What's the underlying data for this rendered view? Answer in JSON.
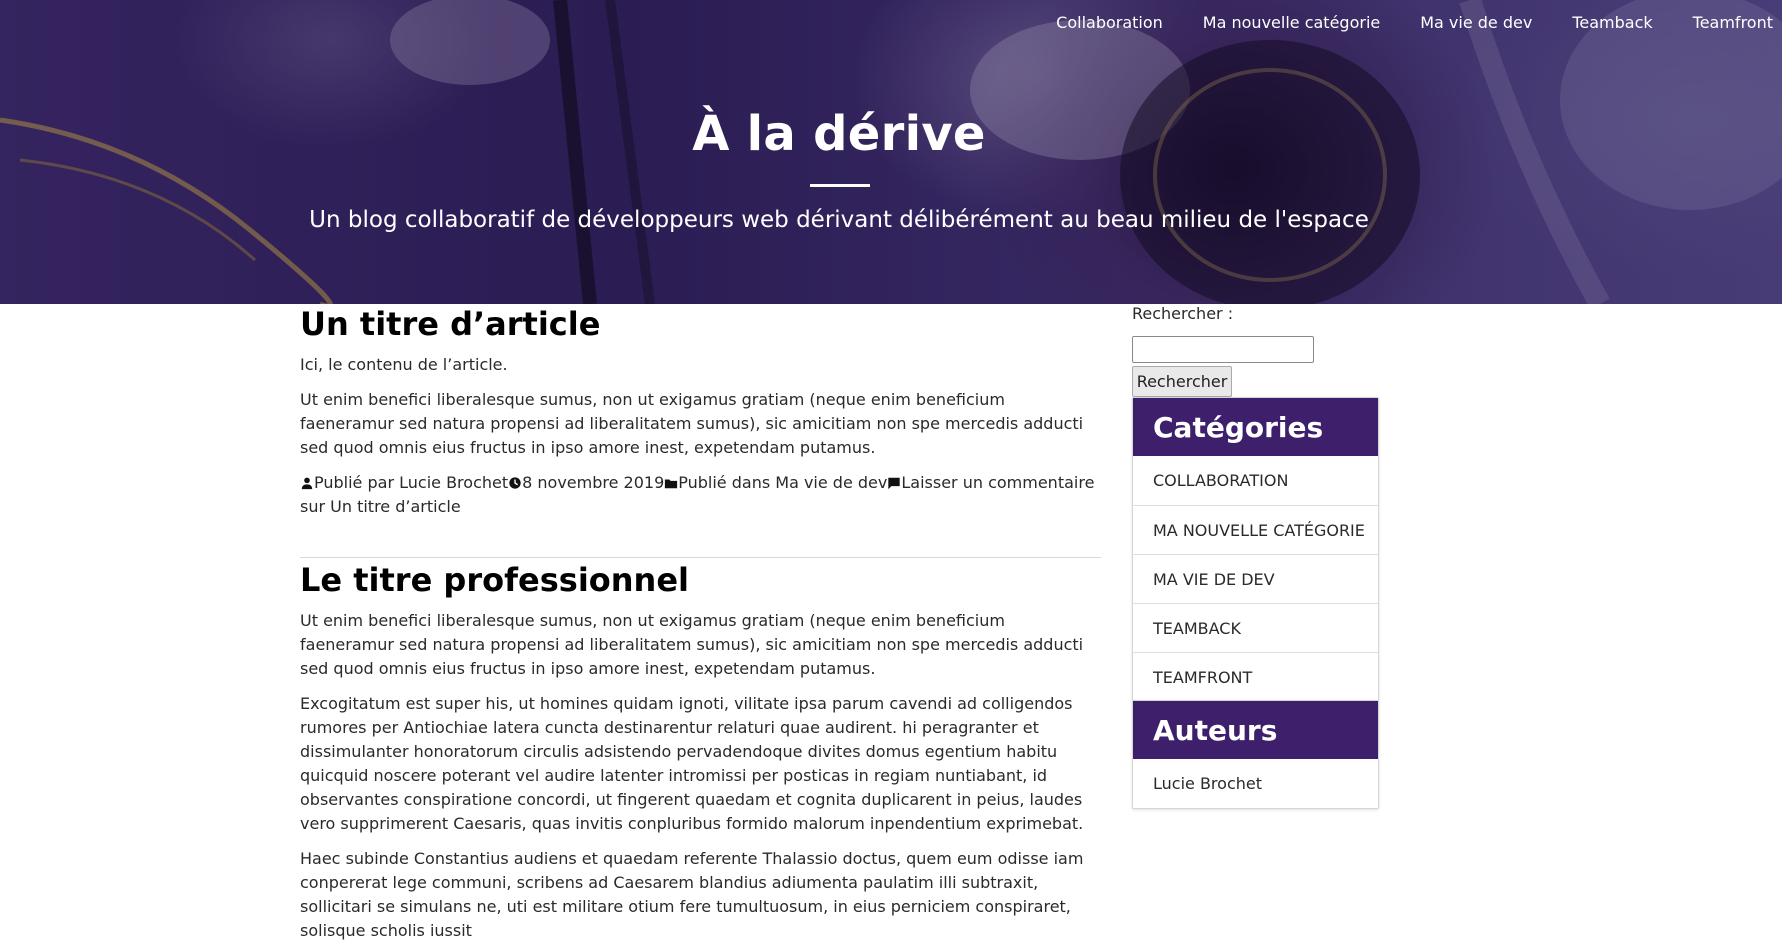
{
  "site": {
    "title": "À la dérive",
    "subtitle": "Un blog collaboratif de développeurs web dérivant délibérément au beau milieu de l'espace",
    "accent": "#3d1f6b"
  },
  "nav": {
    "items": [
      "Collaboration",
      "Ma nouvelle catégorie",
      "Ma vie de dev",
      "Teamback",
      "Teamfront"
    ]
  },
  "articles": [
    {
      "title": "Un titre d’article",
      "paragraphs": [
        "Ici, le contenu de l’article.",
        "Ut enim benefici liberalesque sumus, non ut exigamus gratiam (neque enim beneficium faeneramur sed natura propensi ad liberalitatem sumus), sic amicitiam non spe mercedis adducti sed quod omnis eius fructus in ipso amore inest, expetendam putamus."
      ],
      "meta": {
        "author_prefix": "Publié par",
        "author": "Lucie Brochet",
        "date": "8 novembre 2019",
        "category_prefix": "Publié dans",
        "category": "Ma vie de dev",
        "comment": "Laisser un commentaire",
        "comment_suffix": "sur Un titre d’article",
        "icons": [
          "person-icon",
          "clock-icon",
          "folder-icon",
          "comment-icon"
        ]
      }
    },
    {
      "title": "Le titre professionnel",
      "paragraphs": [
        "Ut enim benefici liberalesque sumus, non ut exigamus gratiam (neque enim beneficium faeneramur sed natura propensi ad liberalitatem sumus), sic amicitiam non spe mercedis adducti sed quod omnis eius fructus in ipso amore inest, expetendam putamus.",
        "Excogitatum est super his, ut homines quidam ignoti, vilitate ipsa parum cavendi ad colligendos rumores per Antiochiae latera cuncta destinarentur relaturi quae audirent. hi peragranter et dissimulanter honoratorum circulis adsistendo pervadendoque divites domus egentium habitu quicquid noscere poterant vel audire latenter intromissi per posticas in regiam nuntiabant, id observantes conspiratione concordi, ut fingerent quaedam et cognita duplicarent in peius, laudes vero supprimerent Caesaris, quas invitis conpluribus formido malorum inpendentium exprimebat.",
        "Haec subinde Constantius audiens et quaedam referente Thalassio doctus, quem eum odisse iam conpererat lege communi, scribens ad Caesarem blandius adiumenta paulatim illi subtraxit, sollicitari se simulans ne, uti est militare otium fere tumultuosum, in eius perniciem conspiraret, solisque scholis iussit"
      ]
    }
  ],
  "sidebar": {
    "search_label": "Rechercher :",
    "search_value": "",
    "search_button": "Rechercher",
    "categories_title": "Catégories",
    "categories": [
      "COLLABORATION",
      "MA NOUVELLE CATÉGORIE",
      "MA VIE DE DEV",
      "TEAMBACK",
      "TEAMFRONT"
    ],
    "authors_title": "Auteurs",
    "authors": [
      "Lucie Brochet"
    ]
  }
}
